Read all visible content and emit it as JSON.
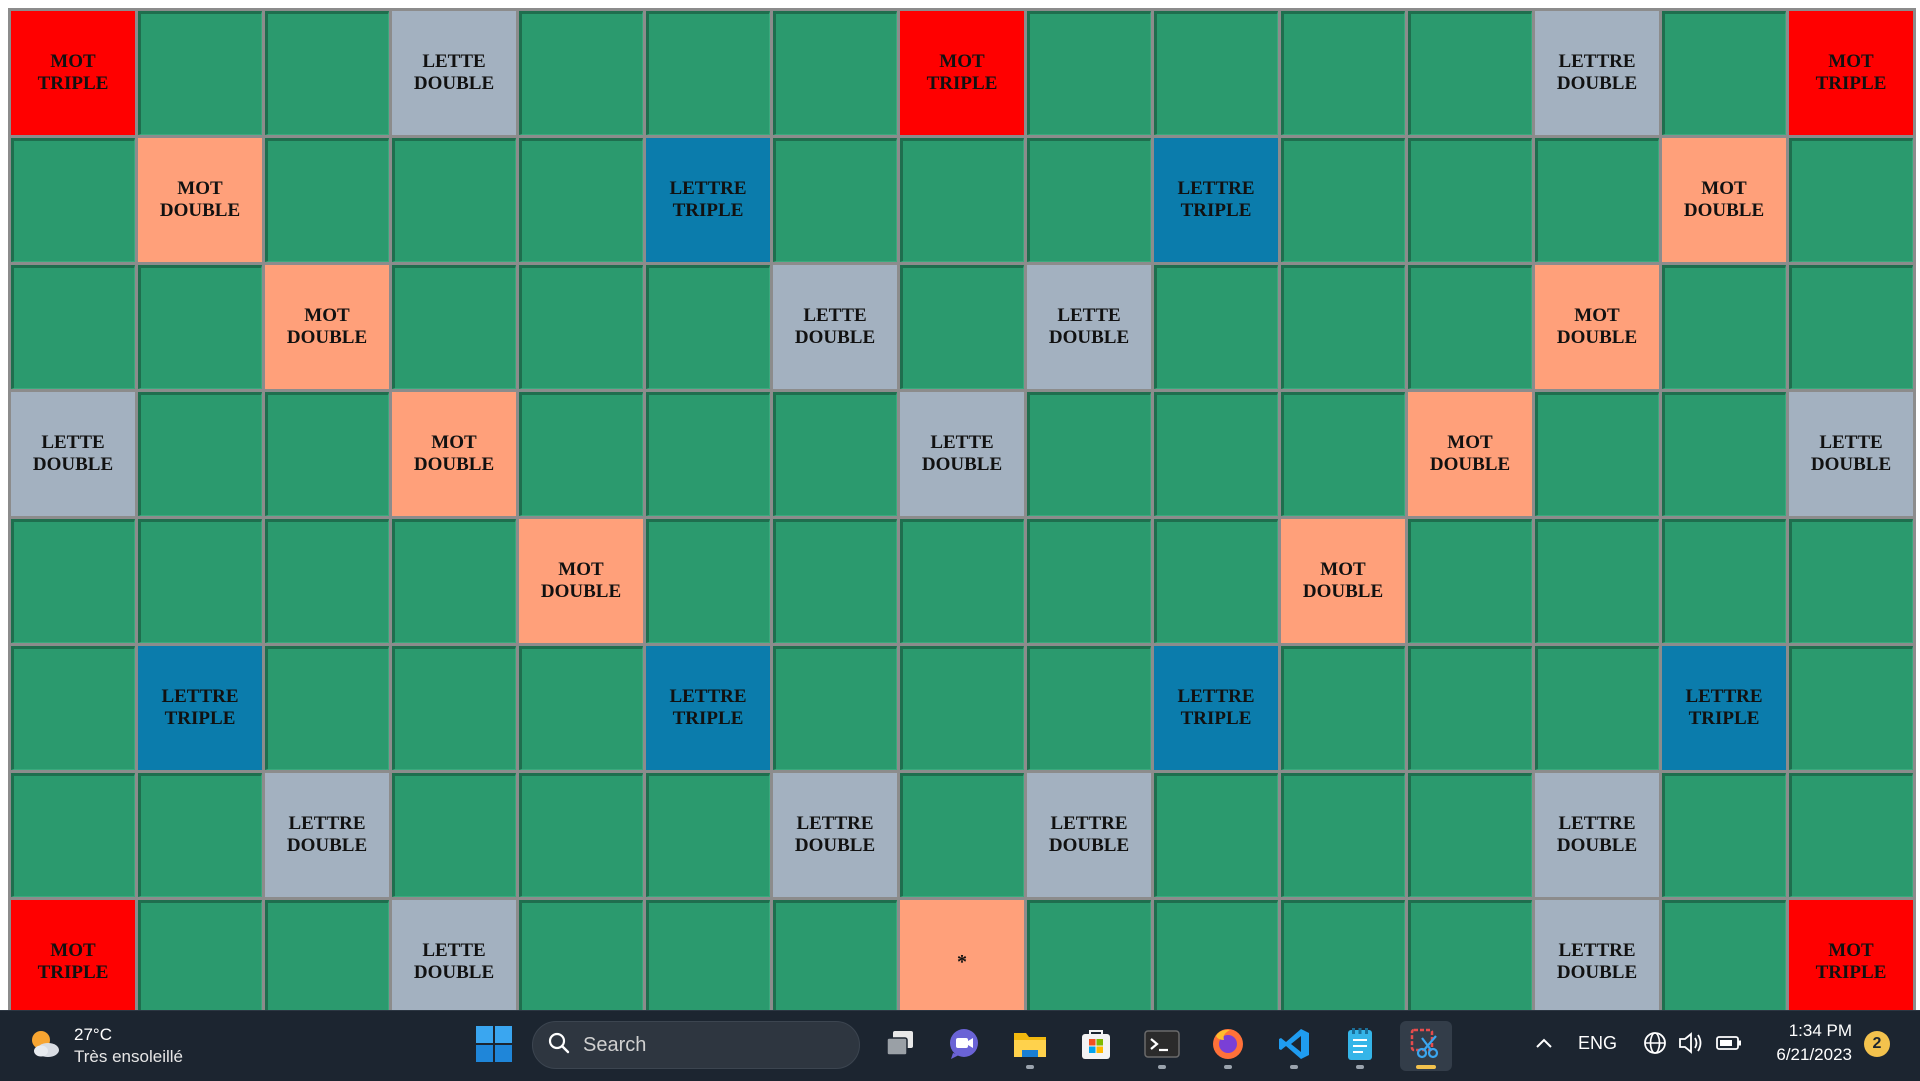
{
  "board": {
    "labels": {
      "mt": "MOT\nTRIPLE",
      "md": "MOT\nDOUBLE",
      "lt": "LETTRE\nTRIPLE",
      "ld_lettre": "LETTRE\nDOUBLE",
      "ld_lette": "LETTE\nDOUBLE",
      "star": "*"
    },
    "colors": {
      "plain": "#2b9a6e",
      "mot_triple": "#ff0000",
      "mot_double": "#ffa07a",
      "lettre_triple": "#0b7cac",
      "lettre_double": "#a3b1c0"
    },
    "rows": [
      [
        "mt",
        "",
        "",
        "ld_lette",
        "",
        "",
        "",
        "mt",
        "",
        "",
        "",
        "",
        "ld_lettre",
        "",
        "mt"
      ],
      [
        "",
        "md",
        "",
        "",
        "",
        "lt",
        "",
        "",
        "",
        "lt",
        "",
        "",
        "",
        "md",
        ""
      ],
      [
        "",
        "",
        "md",
        "",
        "",
        "",
        "ld_lette",
        "",
        "ld_lette",
        "",
        "",
        "",
        "md",
        "",
        ""
      ],
      [
        "ld_lette",
        "",
        "",
        "md",
        "",
        "",
        "",
        "ld_lette",
        "",
        "",
        "",
        "md",
        "",
        "",
        "ld_lette"
      ],
      [
        "",
        "",
        "",
        "",
        "md",
        "",
        "",
        "",
        "",
        "",
        "md",
        "",
        "",
        "",
        ""
      ],
      [
        "",
        "lt",
        "",
        "",
        "",
        "lt",
        "",
        "",
        "",
        "lt",
        "",
        "",
        "",
        "lt",
        ""
      ],
      [
        "",
        "",
        "ld_lettre",
        "",
        "",
        "",
        "ld_lettre",
        "",
        "ld_lettre",
        "",
        "",
        "",
        "ld_lettre",
        "",
        ""
      ],
      [
        "mt",
        "",
        "",
        "ld_lette",
        "",
        "",
        "",
        "star",
        "",
        "",
        "",
        "",
        "ld_lettre",
        "",
        "mt"
      ]
    ]
  },
  "taskbar": {
    "weather": {
      "temp": "27°C",
      "condition": "Très ensoleillé",
      "icon": "partly-sunny-icon"
    },
    "search_placeholder": "Search",
    "apps": [
      {
        "name": "task-view",
        "icon": "task-view-icon"
      },
      {
        "name": "teams-chat",
        "icon": "teams-chat-icon"
      },
      {
        "name": "file-explorer",
        "icon": "folder-icon",
        "running": true
      },
      {
        "name": "microsoft-store",
        "icon": "store-icon"
      },
      {
        "name": "terminal",
        "icon": "terminal-icon",
        "running": true
      },
      {
        "name": "firefox",
        "icon": "firefox-icon",
        "running": true
      },
      {
        "name": "vscode",
        "icon": "vscode-icon",
        "running": true
      },
      {
        "name": "notepad",
        "icon": "notepad-icon",
        "running": true
      },
      {
        "name": "snipping-tool",
        "icon": "snipping-tool-icon",
        "running": true,
        "active": true
      }
    ],
    "language": "ENG",
    "time": "1:34 PM",
    "date": "6/21/2023",
    "notification_count": "2",
    "accent": "#f3c24d"
  }
}
